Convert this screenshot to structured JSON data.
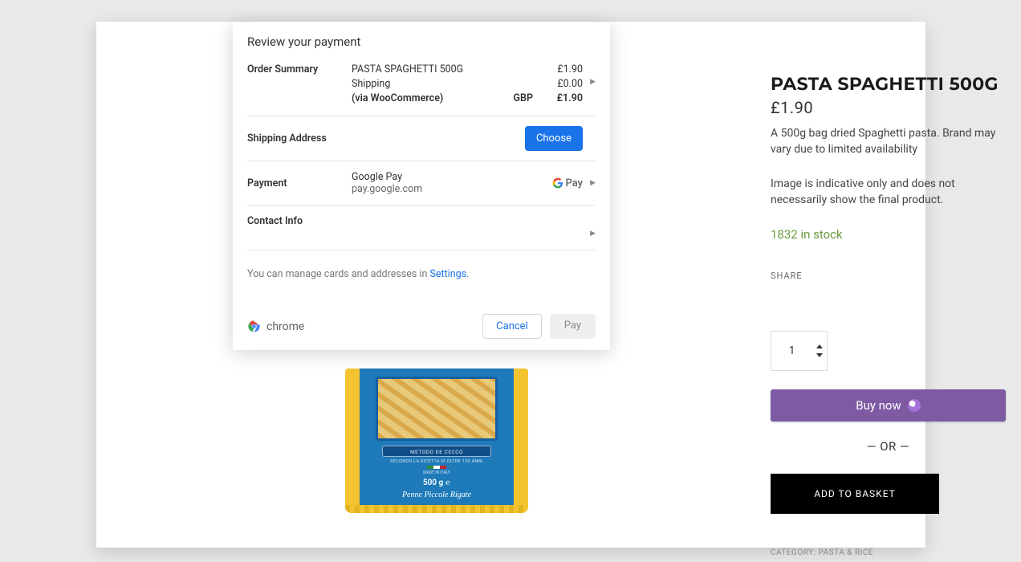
{
  "product": {
    "title": "PASTA SPAGHETTI 500G",
    "price": "£1.90",
    "desc1": "A 500g bag dried  Spaghetti  pasta. Brand may vary due to limited availability",
    "desc2": "Image is indicative only and does not necessarily show the final product.",
    "stock": "1832 in stock",
    "share_label": "SHARE",
    "quantity": "1",
    "buy_now_label": "Buy now",
    "or_divider": "— OR —",
    "add_basket_label": "ADD TO BASKET",
    "category_prefix": "CATEGORY: ",
    "category_value": "PASTA & RICE"
  },
  "package": {
    "banner": "METODO DE CECCO",
    "sub": "SECONDO LA RICETTA DI OLTRE 130 ANNI",
    "madein": "MADE IN ITALY",
    "weight": "500 g ℮",
    "name": "Penne Piccole Rigate"
  },
  "modal": {
    "title": "Review your payment",
    "order_summary_label": "Order Summary",
    "item_name": "PASTA SPAGHETTI  500G",
    "item_price": "£1.90",
    "shipping_label": "Shipping",
    "shipping_price": "£0.00",
    "via_label": "(via WooCommerce)",
    "currency": "GBP",
    "total": "£1.90",
    "shipping_addr_label": "Shipping Address",
    "choose_btn": "Choose",
    "payment_label": "Payment",
    "payment_method": "Google Pay",
    "payment_domain": "pay.google.com",
    "gpay_g": "G",
    "gpay_pay": "Pay",
    "contact_label": "Contact Info",
    "manage_pre": "You can manage cards and addresses in ",
    "manage_link": "Settings",
    "manage_post": ".",
    "brand": "chrome",
    "cancel": "Cancel",
    "pay": "Pay"
  }
}
